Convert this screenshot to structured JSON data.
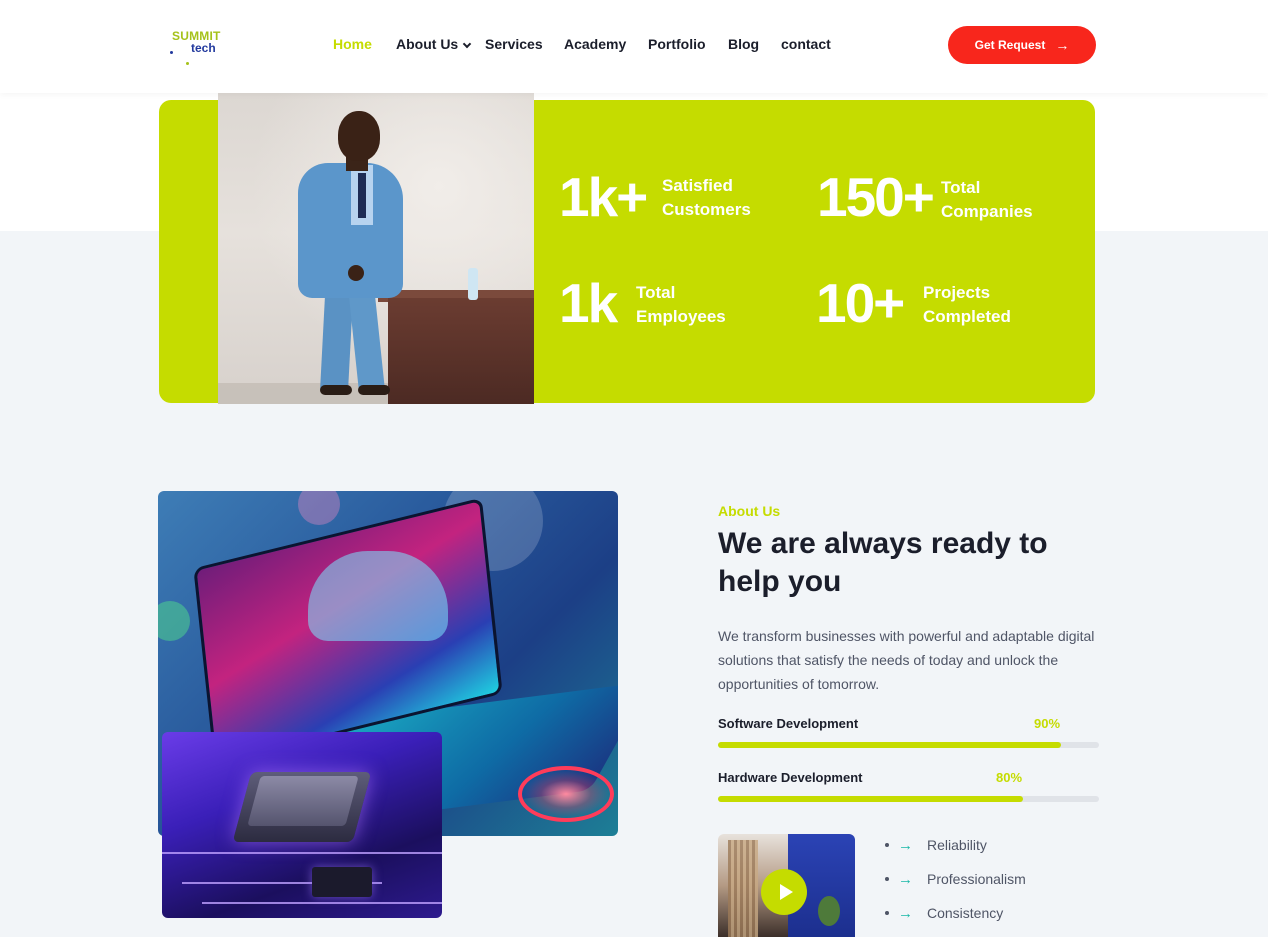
{
  "header": {
    "logo": {
      "line1": "SUMMIT",
      "line2": "tech"
    },
    "nav": [
      {
        "label": "Home",
        "active": true
      },
      {
        "label": "About Us",
        "has_dropdown": true
      },
      {
        "label": "Services"
      },
      {
        "label": "Academy"
      },
      {
        "label": "Portfolio"
      },
      {
        "label": "Blog"
      },
      {
        "label": "contact"
      }
    ],
    "cta_label": "Get Request"
  },
  "stats": [
    {
      "number": "1k+",
      "label_line1": "Satisfied",
      "label_line2": "Customers"
    },
    {
      "number": "150+",
      "label_line1": "Total",
      "label_line2": "Companies"
    },
    {
      "number": "1k",
      "label_line1": "Total",
      "label_line2": "Employees"
    },
    {
      "number": "10+",
      "label_line1": "Projects",
      "label_line2": "Completed"
    }
  ],
  "about": {
    "tag": "About Us",
    "title": "We are always ready to help you",
    "description": "We transform businesses with powerful and adaptable digital solutions that satisfy the needs of today and unlock the opportunities of tomorrow.",
    "skills": [
      {
        "label": "Software Development",
        "percent_text": "90%",
        "value": 90
      },
      {
        "label": "Hardware Development",
        "percent_text": "80%",
        "value": 80
      }
    ],
    "features": [
      "Reliability",
      "Professionalism",
      "Consistency"
    ]
  },
  "colors": {
    "accent": "#c5dc00",
    "cta": "#f8261c",
    "dark_text": "#1b1e2b",
    "body_text": "#4f5566",
    "feature_arrow": "#17b8a6",
    "section_bg": "#f2f5f8"
  },
  "icons": {
    "nav_dropdown": "chevron-down-icon",
    "cta_arrow": "arrow-right-icon",
    "feature_arrow": "arrow-right-icon",
    "video": "play-icon"
  }
}
